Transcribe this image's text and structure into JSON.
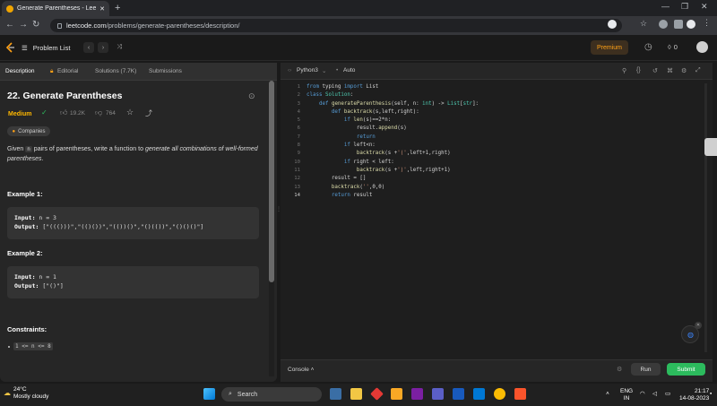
{
  "browser": {
    "tab_title": "Generate Parentheses - LeetCode",
    "url_domain": "leetcode.com",
    "url_path": "/problems/generate-parentheses/description/"
  },
  "header": {
    "problem_list": "Problem List",
    "premium": "Premium",
    "streak": "0"
  },
  "left_tabs": [
    "Description",
    "Editorial",
    "Solutions (7.7K)",
    "Submissions"
  ],
  "problem": {
    "title": "22. Generate Parentheses",
    "difficulty": "Medium",
    "likes": "19.2K",
    "dislikes": "764",
    "companies": "Companies",
    "desc_pre": "Given ",
    "desc_code": "n",
    "desc_mid": " pairs of parentheses, write a function to ",
    "desc_em": "generate all combinations of well-formed parentheses",
    "desc_post": "."
  },
  "examples": [
    {
      "heading": "Example 1:",
      "input_label": "Input:",
      "input": "n = 3",
      "output_label": "Output:",
      "output": "[\"((()))\",\"(()())\",\"(())()\",\"()(())\",\"()()()\"]"
    },
    {
      "heading": "Example 2:",
      "input_label": "Input:",
      "input": "n = 1",
      "output_label": "Output:",
      "output": "[\"()\"]"
    }
  ],
  "constraints": {
    "heading": "Constraints:",
    "item": "1 <= n <= 8"
  },
  "editor": {
    "language": "Python3",
    "mode": "Auto",
    "line_numbers": [
      "1",
      "2",
      "3",
      "4",
      "5",
      "6",
      "7",
      "8",
      "9",
      "10",
      "11",
      "12",
      "13",
      "14"
    ],
    "console": "Console",
    "run": "Run",
    "submit": "Submit"
  },
  "taskbar": {
    "temp": "24°C",
    "weather": "Mostly cloudy",
    "search": "Search",
    "lang1": "ENG",
    "lang2": "IN",
    "time": "21:17",
    "date": "14-08-2023"
  }
}
